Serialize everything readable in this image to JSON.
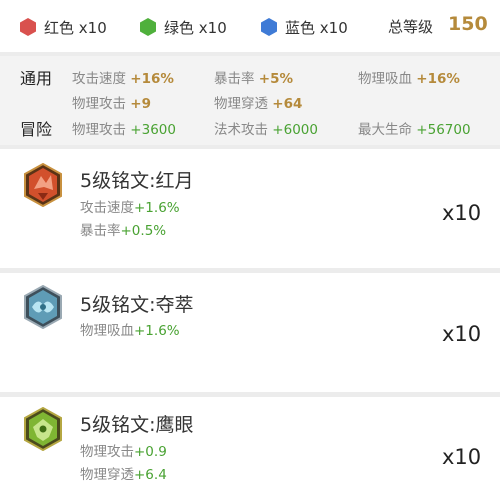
{
  "header": {
    "gems": [
      {
        "icon": "red-hex-icon",
        "color": "#d9514e",
        "label": "红色 x10"
      },
      {
        "icon": "green-hex-icon",
        "color": "#4fb03c",
        "label": "绿色 x10"
      },
      {
        "icon": "blue-hex-icon",
        "color": "#3f7bd6",
        "label": "蓝色 x10"
      }
    ],
    "total_label": "总等级",
    "total_value": "150"
  },
  "summary": {
    "general_label": "通用",
    "adventure_label": "冒险",
    "general_stats": [
      {
        "name": "攻击速度",
        "value": "+16%"
      },
      {
        "name": "暴击率",
        "value": "+5%"
      },
      {
        "name": "物理吸血",
        "value": "+16%"
      },
      {
        "name": "物理攻击",
        "value": "+9"
      },
      {
        "name": "物理穿透",
        "value": "+64"
      }
    ],
    "adventure_stats": [
      {
        "name": "物理攻击",
        "value": "+3600"
      },
      {
        "name": "法术攻击",
        "value": "+6000"
      },
      {
        "name": "最大生命",
        "value": "+56700"
      }
    ]
  },
  "inscriptions": [
    {
      "icon": "red-moon-emblem-icon",
      "title": "5级铭文:红月",
      "attrs": [
        {
          "name": "攻击速度",
          "value": "+1.6%"
        },
        {
          "name": "暴击率",
          "value": "+0.5%"
        }
      ],
      "count": "x10"
    },
    {
      "icon": "seize-emblem-icon",
      "title": "5级铭文:夺萃",
      "attrs": [
        {
          "name": "物理吸血",
          "value": "+1.6%"
        }
      ],
      "count": "x10"
    },
    {
      "icon": "hawk-eye-emblem-icon",
      "title": "5级铭文:鹰眼",
      "attrs": [
        {
          "name": "物理攻击",
          "value": "+0.9"
        },
        {
          "name": "物理穿透",
          "value": "+6.4"
        }
      ],
      "count": "x10"
    }
  ]
}
